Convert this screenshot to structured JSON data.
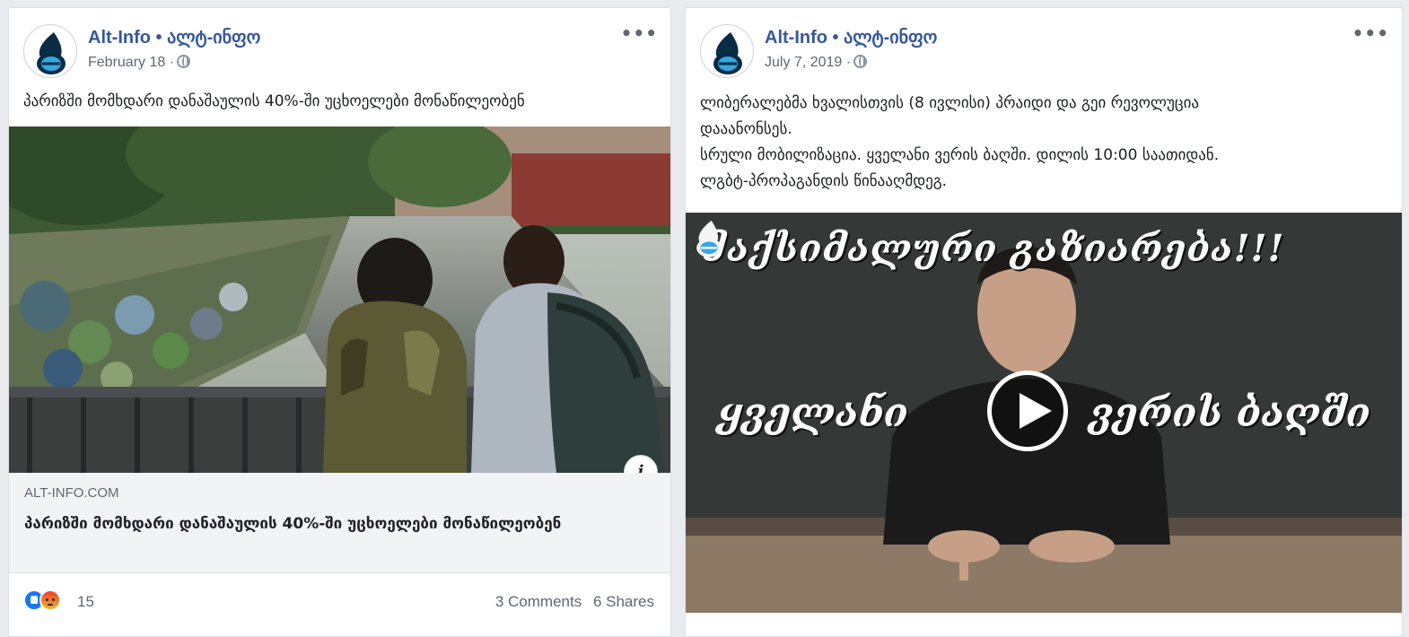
{
  "posts": [
    {
      "page_name": "Alt-Info • ალტ-ინფო",
      "date": "February 18 ·",
      "more_label": "•••",
      "text": [
        "პარიზში მომხდარი დანაშაულის 40%-ში უცხოელები მონაწილეობენ"
      ],
      "link": {
        "domain": "ALT-INFO.COM",
        "title": "პარიზში მომხდარი დანაშაულის 40%-ში უცხოელები მონაწილეობენ",
        "info_label": "i"
      },
      "reactions": {
        "icons": [
          "like-icon",
          "angry-icon"
        ],
        "count": "15"
      },
      "comments": "3 Comments",
      "shares": "6 Shares"
    },
    {
      "page_name": "Alt-Info • ალტ-ინფო",
      "date": "July 7, 2019 ·",
      "more_label": "•••",
      "text": [
        "ლიბერალებმა ხვალისთვის (8 ივლისი) პრაიდი და გეი რევოლუცია",
        "დააანონსეს.",
        "სრული მობილიზაცია. ყველანი ვერის ბაღში. დილის 10:00 საათიდან.",
        "ლგბტ-პროპაგანდის წინააღმდეგ."
      ],
      "video": {
        "headline": "მაქსიმალური გაზიარება!!!",
        "word_left": "ყველანი",
        "word_right": "ვერის ბაღში"
      }
    }
  ],
  "colors": {
    "link_blue": "#365899",
    "meta_gray": "#616770",
    "preview_bg": "#f2f3f5",
    "like_blue": "#1877f2"
  }
}
